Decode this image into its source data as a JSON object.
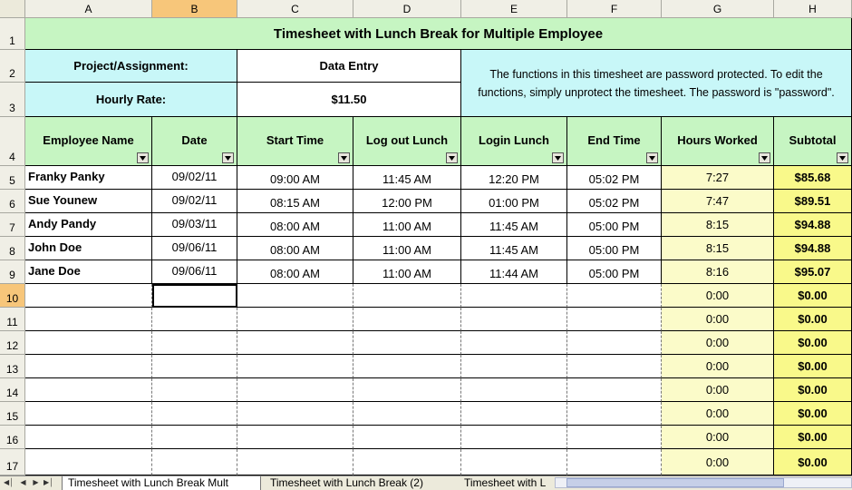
{
  "columns": [
    "A",
    "B",
    "C",
    "D",
    "E",
    "F",
    "G",
    "H"
  ],
  "rows": [
    "1",
    "2",
    "3",
    "4",
    "5",
    "6",
    "7",
    "8",
    "9",
    "10",
    "11",
    "12",
    "13",
    "14",
    "15",
    "16",
    "17"
  ],
  "title": "Timesheet with Lunch Break for Multiple Employee",
  "project_label": "Project/Assignment:",
  "project_value": "Data Entry",
  "rate_label": "Hourly Rate:",
  "rate_value": "$11.50",
  "note": "The functions in this timesheet are password protected. To edit the functions, simply unprotect the timesheet. The password is \"password\".",
  "headers": [
    "Employee Name",
    "Date",
    "Start Time",
    "Log out Lunch",
    "Login Lunch",
    "End Time",
    "Hours Worked",
    "Subtotal"
  ],
  "entries": [
    [
      "Franky Panky",
      "09/02/11",
      "09:00 AM",
      "11:45 AM",
      "12:20 PM",
      "05:02 PM",
      "7:27",
      "$85.68"
    ],
    [
      "Sue Younew",
      "09/02/11",
      "08:15 AM",
      "12:00 PM",
      "01:00 PM",
      "05:02 PM",
      "7:47",
      "$89.51"
    ],
    [
      "Andy Pandy",
      "09/03/11",
      "08:00 AM",
      "11:00 AM",
      "11:45 AM",
      "05:00 PM",
      "8:15",
      "$94.88"
    ],
    [
      "John Doe",
      "09/06/11",
      "08:00 AM",
      "11:00 AM",
      "11:45 AM",
      "05:00 PM",
      "8:15",
      "$94.88"
    ],
    [
      "Jane Doe",
      "09/06/11",
      "08:00 AM",
      "11:00 AM",
      "11:44 AM",
      "05:00 PM",
      "8:16",
      "$95.07"
    ],
    [
      "",
      "",
      "",
      "",
      "",
      "",
      "0:00",
      "$0.00"
    ],
    [
      "",
      "",
      "",
      "",
      "",
      "",
      "0:00",
      "$0.00"
    ],
    [
      "",
      "",
      "",
      "",
      "",
      "",
      "0:00",
      "$0.00"
    ],
    [
      "",
      "",
      "",
      "",
      "",
      "",
      "0:00",
      "$0.00"
    ],
    [
      "",
      "",
      "",
      "",
      "",
      "",
      "0:00",
      "$0.00"
    ],
    [
      "",
      "",
      "",
      "",
      "",
      "",
      "0:00",
      "$0.00"
    ],
    [
      "",
      "",
      "",
      "",
      "",
      "",
      "0:00",
      "$0.00"
    ],
    [
      "",
      "",
      "",
      "",
      "",
      "",
      "0:00",
      "$0.00"
    ]
  ],
  "tabs": [
    "Timesheet with Lunch Break Mult",
    "Timesheet with Lunch Break  (2)",
    "Timesheet with L"
  ],
  "selected_column": "B",
  "selected_row": "10",
  "colors": {
    "title_bg": "#c6f5c2",
    "info_bg": "#c8f7f8",
    "hours_bg": "#fbfbc9",
    "subtotal_bg": "#f9f98a",
    "select_hdr": "#f7c67a"
  }
}
